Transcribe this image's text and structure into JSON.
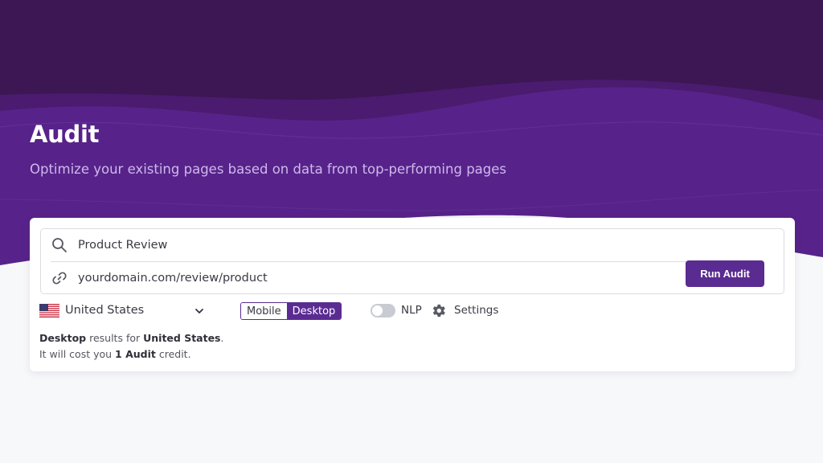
{
  "page": {
    "title": "Audit",
    "subtitle": "Optimize your existing pages based on data from top-performing pages"
  },
  "colors": {
    "hero_dark": "#3d1654",
    "hero_mid": "#4a1b6f",
    "hero_light": "#57238a",
    "accent": "#5a2b91",
    "background": "#f7f8fa"
  },
  "form": {
    "keyword": {
      "value": "Product Review",
      "icon": "search-icon"
    },
    "url": {
      "value": "yourdomain.com/review/product",
      "icon": "link-icon"
    },
    "run_button_label": "Run Audit"
  },
  "options": {
    "country": {
      "flag": "us-flag-icon",
      "selected": "United States"
    },
    "device": {
      "options": [
        "Mobile",
        "Desktop"
      ],
      "selected": "Desktop"
    },
    "nlp": {
      "label": "NLP",
      "enabled": false
    },
    "settings_label": "Settings"
  },
  "summary": {
    "line1": {
      "device": "Desktop",
      "middle": " results for ",
      "country": "United States",
      "end": "."
    },
    "line2": {
      "prefix": "It will cost you ",
      "credit": "1 Audit",
      "suffix": " credit."
    }
  }
}
